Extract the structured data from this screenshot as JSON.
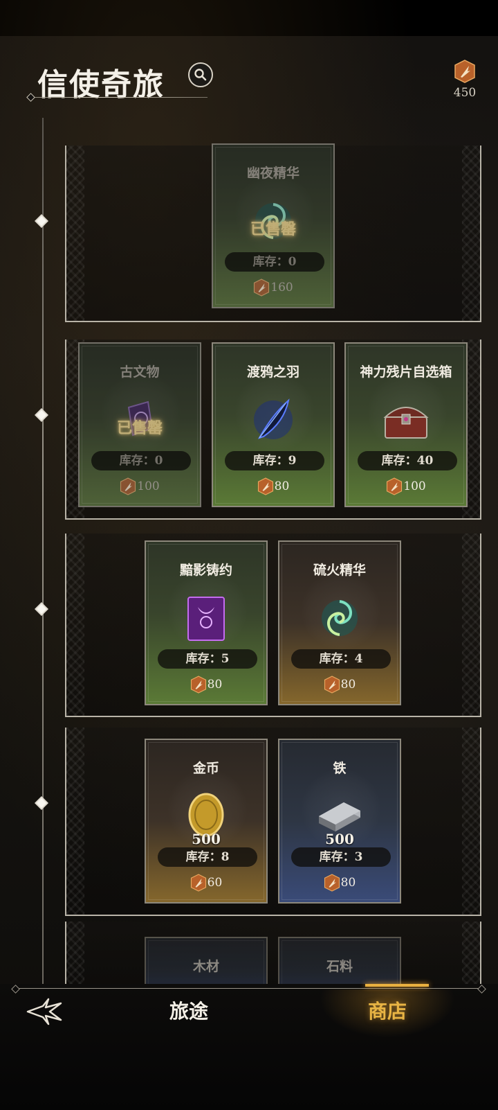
{
  "header": {
    "title": "信使奇旅",
    "currency_value": "450",
    "icons": {
      "search": "search-icon",
      "currency": "feather-token-icon"
    }
  },
  "colors": {
    "accent_gold": "#e8b444",
    "sold_out": "#f2d37a"
  },
  "tiers": [
    {
      "cards": [
        {
          "name": "幽夜精华",
          "icon": "swirl-essence-icon",
          "status": "已售罄",
          "stock_label": "库存：0",
          "price": "160",
          "theme": "green",
          "sold_out": true
        }
      ]
    },
    {
      "cards": [
        {
          "name": "古文物",
          "icon": "ancient-relic-icon",
          "status": "已售罄",
          "stock_label": "库存：0",
          "price": "100",
          "theme": "green",
          "sold_out": true
        },
        {
          "name": "渡鸦之羽",
          "icon": "raven-feather-icon",
          "stock_label": "库存：9",
          "price": "80",
          "theme": "green"
        },
        {
          "name": "神力残片自选箱",
          "icon": "treasure-chest-icon",
          "stock_label": "库存：40",
          "price": "100",
          "theme": "green"
        }
      ]
    },
    {
      "cards": [
        {
          "name": "黯影铸约",
          "icon": "shadow-pact-icon",
          "stock_label": "库存：5",
          "price": "80",
          "theme": "green"
        },
        {
          "name": "硫火精华",
          "icon": "swirl-essence-icon",
          "stock_label": "库存：4",
          "price": "80",
          "theme": "brown"
        }
      ]
    },
    {
      "cards": [
        {
          "name": "金币",
          "icon": "gold-coin-icon",
          "amount": "500",
          "stock_label": "库存：8",
          "price": "60",
          "theme": "brown"
        },
        {
          "name": "铁",
          "icon": "iron-ingot-icon",
          "amount": "500",
          "stock_label": "库存：3",
          "price": "80",
          "theme": "blue"
        }
      ]
    },
    {
      "cards": [
        {
          "name": "木材",
          "icon": "wood-log-icon",
          "theme": "blue"
        },
        {
          "name": "石料",
          "icon": "stone-icon",
          "theme": "blue"
        }
      ]
    }
  ],
  "nav": {
    "back_icon": "back-arrow-icon",
    "journey": "旅途",
    "shop": "商店",
    "active": "shop"
  }
}
